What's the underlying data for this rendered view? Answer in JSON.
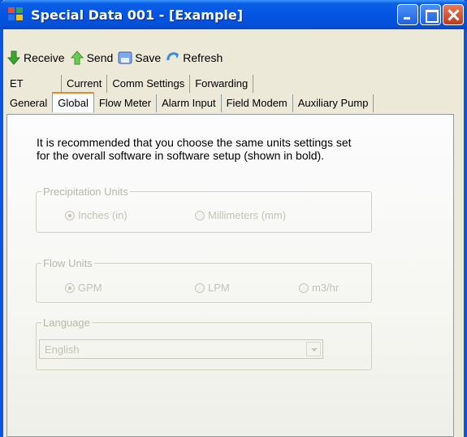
{
  "window": {
    "title": "Special Data 001 - [Example]"
  },
  "toolbar": {
    "receive_label": "Receive",
    "send_label": "Send",
    "save_label": "Save",
    "refresh_label": "Refresh"
  },
  "tabs_row1": [
    "ET",
    "Current",
    "Comm Settings",
    "Forwarding"
  ],
  "tabs_row2": [
    "General",
    "Global",
    "Flow Meter",
    "Alarm Input",
    "Field Modem",
    "Auxiliary Pump"
  ],
  "selected_tab": "Global",
  "note": {
    "line1": "It is recommended that you choose the same units settings set",
    "line2": "for the overall software in software setup (shown in bold)."
  },
  "precipitation": {
    "legend": "Precipitation Units",
    "option1": "Inches (in)",
    "option2": "Millimeters (mm)",
    "selected": "Inches (in)"
  },
  "flow": {
    "legend": "Flow Units",
    "option1": "GPM",
    "option2": "LPM",
    "option3": "m3/hr",
    "selected": "GPM"
  },
  "language": {
    "legend": "Language",
    "value": "English"
  },
  "colors": {
    "titlebar": "#0554e3",
    "selected_tab_accent": "#e68b2c",
    "disabled_text": "#c3c3b4"
  }
}
